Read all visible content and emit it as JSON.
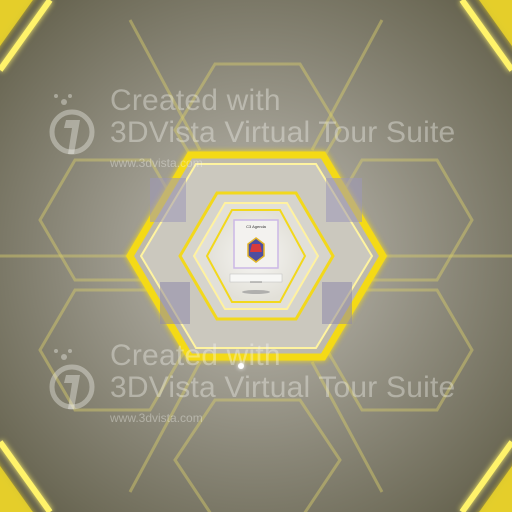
{
  "watermark": {
    "line1": "Created with",
    "line2": "3DVista Virtual Tour Suite",
    "url": "www.3dvista.com",
    "logo_icon": "3dvista-logo-icon"
  },
  "screen": {
    "title": "C3 Agenda"
  },
  "colors": {
    "hex_frame": "#f2d81c",
    "hex_glow": "#fff36b",
    "wall": "#8a8778"
  },
  "nav_dot_icon": "hotspot-dot-icon"
}
